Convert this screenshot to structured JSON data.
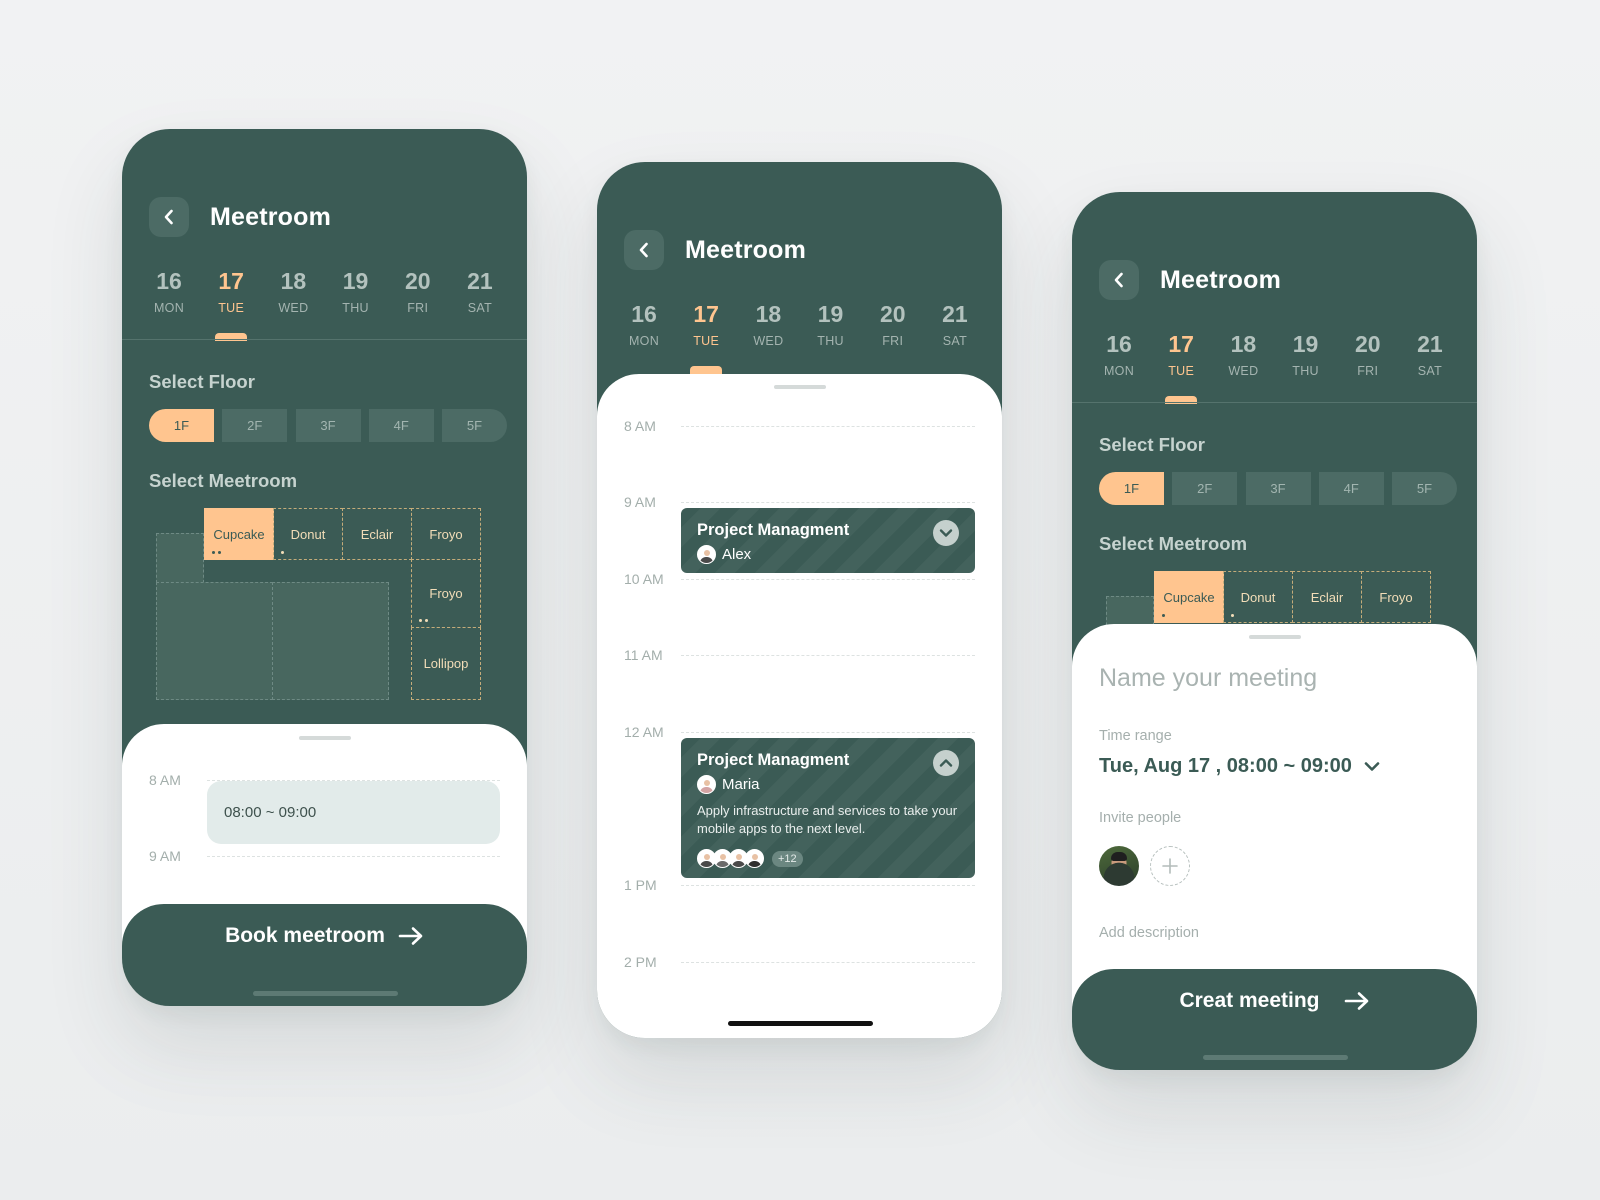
{
  "app": {
    "title": "Meetroom"
  },
  "days": [
    {
      "num": "16",
      "wd": "MON"
    },
    {
      "num": "17",
      "wd": "TUE"
    },
    {
      "num": "18",
      "wd": "WED"
    },
    {
      "num": "19",
      "wd": "THU"
    },
    {
      "num": "20",
      "wd": "FRI"
    },
    {
      "num": "21",
      "wd": "SAT"
    }
  ],
  "selected_day": "17",
  "select_floor": {
    "title": "Select Floor",
    "floors": [
      "1F",
      "2F",
      "3F",
      "4F",
      "5F"
    ],
    "selected": "1F"
  },
  "select_meetroom": {
    "title": "Select Meetroom",
    "rooms": [
      "Cupcake",
      "Donut",
      "Eclair",
      "Froyo",
      "Froyo",
      "Lollipop"
    ],
    "selected": "Cupcake"
  },
  "screen1": {
    "times": [
      "8 AM",
      "9 AM"
    ],
    "slot": "08:00 ~ 09:00",
    "cta": "Book meetroom"
  },
  "screen2": {
    "times": [
      "8 AM",
      "9 AM",
      "10 AM",
      "11 AM",
      "12 AM",
      "1 PM",
      "2 PM"
    ],
    "events": [
      {
        "title": "Project Managment",
        "person": "Alex"
      },
      {
        "title": "Project Managment",
        "person": "Maria",
        "description": "Apply infrastructure and services to take your mobile apps to the next level.",
        "more": "+12"
      }
    ]
  },
  "screen3": {
    "name_placeholder": "Name your meeting",
    "time_range_label": "Time range",
    "time_range_value": "Tue, Aug 17 , 08:00 ~ 09:00",
    "invite_label": "Invite people",
    "add_description": "Add description",
    "cta": "Creat meeting"
  },
  "colors": {
    "primary": "#3b5b55",
    "accent": "#ffc58f",
    "sheet": "#ffffff",
    "slot": "#e2ebea",
    "background": "#eeeff0"
  },
  "icons": [
    "chevron-left-icon",
    "arrow-right-icon",
    "chevron-down-icon",
    "chevron-up-icon",
    "plus-icon"
  ]
}
